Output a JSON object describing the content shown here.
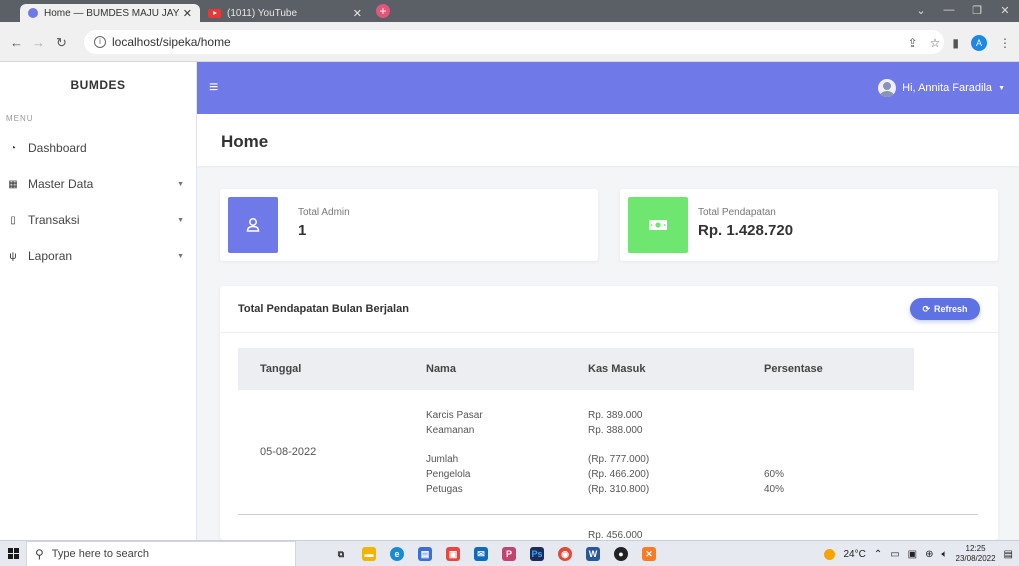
{
  "browser": {
    "tabs": [
      {
        "title": "Home — BUMDES MAJU JAYA",
        "active": true
      },
      {
        "title": "(1011) YouTube",
        "active": false
      }
    ],
    "url": "localhost/sipeka/home"
  },
  "sidebar": {
    "brand": "BUMDES",
    "menu_heading": "MENU",
    "items": [
      {
        "label": "Dashboard",
        "icon": "gauge-icon",
        "has_caret": false
      },
      {
        "label": "Master Data",
        "icon": "grid-icon",
        "has_caret": true
      },
      {
        "label": "Transaksi",
        "icon": "file-icon",
        "has_caret": true
      },
      {
        "label": "Laporan",
        "icon": "plug-icon",
        "has_caret": true
      }
    ]
  },
  "topnav": {
    "user_greeting": "Hi, Annita Faradila",
    "color": "#6f7ae8"
  },
  "page": {
    "title": "Home"
  },
  "stats": [
    {
      "label": "Total Admin",
      "value": "1",
      "icon": "user-icon",
      "color": "#6f7ae8"
    },
    {
      "label": "Total Pendapatan",
      "value": "Rp. 1.428.720",
      "icon": "money-icon",
      "color": "#6ee66f"
    }
  ],
  "panel": {
    "title": "Total Pendapatan Bulan Berjalan",
    "refresh_label": "Refresh",
    "columns": [
      "Tanggal",
      "Nama",
      "Kas Masuk",
      "Persentase"
    ],
    "rows": [
      {
        "tanggal": "05-08-2022",
        "items": [
          {
            "nama": "Karcis Pasar",
            "kas": "Rp. 389.000",
            "persen": ""
          },
          {
            "nama": "Keamanan",
            "kas": "Rp. 388.000",
            "persen": ""
          }
        ],
        "summary": [
          {
            "nama": "Jumlah",
            "kas": "(Rp. 777.000)",
            "persen": ""
          },
          {
            "nama": "Pengelola",
            "kas": "(Rp. 466.200)",
            "persen": "60%"
          },
          {
            "nama": "Petugas",
            "kas": "(Rp. 310.800)",
            "persen": "40%"
          }
        ]
      }
    ],
    "next_row_partial_kas": "Rp. 456.000"
  },
  "taskbar": {
    "search_placeholder": "Type here to search",
    "temperature": "24°C",
    "time": "12:25",
    "date": "23/08/2022"
  }
}
